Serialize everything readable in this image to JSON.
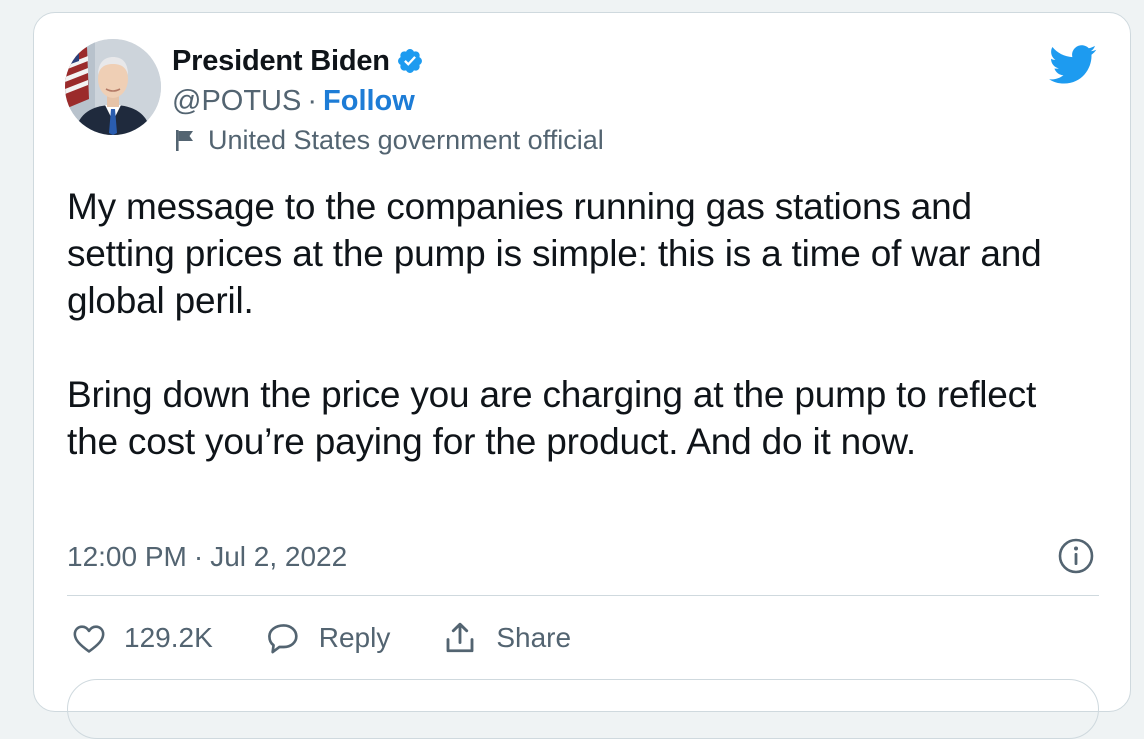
{
  "tweet": {
    "author": {
      "name": "President Biden",
      "handle": "@POTUS",
      "separator": "·",
      "follow_label": "Follow",
      "account_label": "United States government official",
      "avatar_icon": "portrait-avatar",
      "verified_icon": "verified-badge-icon"
    },
    "text": {
      "paragraph_1": "My message to the companies running gas stations and setting prices at the pump is simple: this is a time of war and global peril.",
      "paragraph_2": "Bring down the price you are charging at the pump to reflect the cost you’re paying for the product. And do it now."
    },
    "meta": {
      "time": "12:00 PM",
      "separator": "·",
      "date": "Jul 2, 2022"
    },
    "actions": {
      "like_count": "129.2K",
      "reply_label": "Reply",
      "share_label": "Share"
    }
  },
  "colors": {
    "brand_blue": "#1d9bf0",
    "follow_link": "#1d7cd6",
    "text_primary": "#0f1419",
    "text_secondary": "#536471",
    "border": "#cfd9de"
  }
}
